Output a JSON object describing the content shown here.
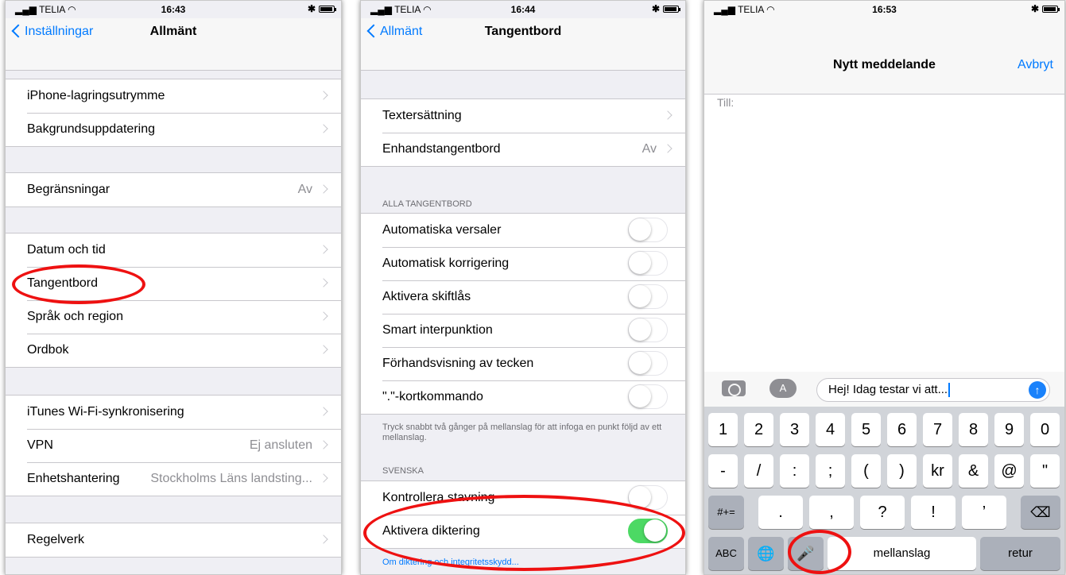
{
  "phone1": {
    "status": {
      "carrier": "TELIA",
      "time": "16:43"
    },
    "nav": {
      "back": "Inställningar",
      "title": "Allmänt"
    },
    "groups": [
      [
        {
          "label": "iPhone-lagringsutrymme",
          "value": ""
        },
        {
          "label": "Bakgrundsuppdatering",
          "value": ""
        }
      ],
      [
        {
          "label": "Begränsningar",
          "value": "Av"
        }
      ],
      [
        {
          "label": "Datum och tid",
          "value": ""
        },
        {
          "label": "Tangentbord",
          "value": ""
        },
        {
          "label": "Språk och region",
          "value": ""
        },
        {
          "label": "Ordbok",
          "value": ""
        }
      ],
      [
        {
          "label": "iTunes Wi-Fi-synkronisering",
          "value": ""
        },
        {
          "label": "VPN",
          "value": "Ej ansluten"
        },
        {
          "label": "Enhetshantering",
          "value": "Stockholms Läns landsting..."
        }
      ],
      [
        {
          "label": "Regelverk",
          "value": ""
        }
      ]
    ]
  },
  "phone2": {
    "status": {
      "carrier": "TELIA",
      "time": "16:44"
    },
    "nav": {
      "back": "Allmänt",
      "title": "Tangentbord"
    },
    "group1": [
      {
        "label": "Textersättning",
        "value": ""
      },
      {
        "label": "Enhandstangentbord",
        "value": "Av"
      }
    ],
    "section_all": "ALLA TANGENTBORD",
    "toggles": [
      {
        "label": "Automatiska versaler",
        "on": false
      },
      {
        "label": "Automatisk korrigering",
        "on": false
      },
      {
        "label": "Aktivera skiftlås",
        "on": false
      },
      {
        "label": "Smart interpunktion",
        "on": false
      },
      {
        "label": "Förhandsvisning av tecken",
        "on": false
      },
      {
        "label": "\".\"-kortkommando",
        "on": false
      }
    ],
    "footer": "Tryck snabbt två gånger på mellanslag för att infoga en punkt följd av ett mellanslag.",
    "section_sv": "SVENSKA",
    "sv_toggles": [
      {
        "label": "Kontrollera stavning",
        "on": false
      },
      {
        "label": "Aktivera diktering",
        "on": true
      }
    ],
    "link": "Om diktering och integritetsskydd..."
  },
  "phone3": {
    "status": {
      "carrier": "TELIA",
      "time": "16:53"
    },
    "title": "Nytt meddelande",
    "cancel": "Avbryt",
    "to_label": "Till:",
    "message": "Hej! Idag testar vi att...",
    "apps_icon": "A",
    "send_icon": "↑",
    "keyboard": {
      "row1": [
        "1",
        "2",
        "3",
        "4",
        "5",
        "6",
        "7",
        "8",
        "9",
        "0"
      ],
      "row2": [
        "-",
        "/",
        ":",
        ";",
        "(",
        ")",
        "kr",
        "&",
        "@",
        "\""
      ],
      "row3": [
        "#+=",
        ".",
        ",",
        "?",
        "!",
        "’",
        "⌫"
      ],
      "row4": {
        "abc": "ABC",
        "globe": "🌐",
        "mic": "🎤",
        "space": "mellanslag",
        "return": "retur"
      }
    }
  },
  "colors": {
    "accent": "#007aff",
    "toggle_on": "#4cd964",
    "highlight": "#e11111"
  }
}
